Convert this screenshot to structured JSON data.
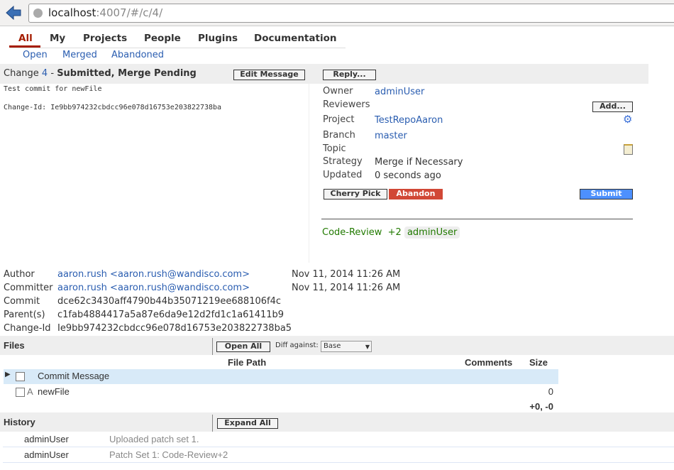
{
  "browser": {
    "url_host": "localhost",
    "url_path": ":4007/#/c/4/"
  },
  "nav": {
    "tabs": [
      "All",
      "My",
      "Projects",
      "People",
      "Plugins",
      "Documentation"
    ],
    "active": "All",
    "subtabs": [
      "Open",
      "Merged",
      "Abandoned"
    ],
    "accent": "#a51d00"
  },
  "change": {
    "prefix": "Change",
    "number": "4",
    "sep": "-",
    "status": "Submitted, Merge Pending",
    "edit_message": "Edit Message",
    "reply": "Reply...",
    "message_line1": "Test commit for newFile",
    "message_line2": "Change-Id: Ie9bb974232cbdcc96e078d16753e203822738ba"
  },
  "info": {
    "owner_label": "Owner",
    "owner": "adminUser",
    "reviewers_label": "Reviewers",
    "add": "Add...",
    "project_label": "Project",
    "project": "TestRepoAaron",
    "branch_label": "Branch",
    "branch": "master",
    "topic_label": "Topic",
    "strategy_label": "Strategy",
    "strategy": "Merge if Necessary",
    "updated_label": "Updated",
    "updated": "0 seconds ago",
    "cherry_pick": "Cherry Pick",
    "abandon": "Abandon",
    "submit": "Submit",
    "abandon_color": "#d14836",
    "submit_color": "#4d90fe",
    "label_name": "Code-Review",
    "label_value": "+2",
    "label_user": "adminUser"
  },
  "commit": {
    "author_label": "Author",
    "author": "aaron.rush <aaron.rush@wandisco.com>",
    "author_date": "Nov 11, 2014 11:26 AM",
    "committer_label": "Committer",
    "committer": "aaron.rush <aaron.rush@wandisco.com>",
    "committer_date": "Nov 11, 2014 11:26 AM",
    "commit_label": "Commit",
    "commit": "dce62c3430aff4790b44b35071219ee688106f4c",
    "parent_label": "Parent(s)",
    "parent": "c1fab4884417a5a87e6da9e12d2fd1c1a61411b9",
    "changeid_label": "Change-Id",
    "changeid": "Ie9bb974232cbdcc96e078d16753e203822738ba5"
  },
  "files": {
    "title": "Files",
    "open_all": "Open All",
    "diff_label": "Diff against:",
    "diff_value": "Base",
    "col_path": "File Path",
    "col_comments": "Comments",
    "col_size": "Size",
    "rows": [
      {
        "status": "",
        "name": "Commit Message",
        "size": ""
      },
      {
        "status": "A",
        "name": "newFile",
        "size": "0"
      }
    ],
    "total": "+0, -0"
  },
  "history": {
    "title": "History",
    "expand_all": "Expand All",
    "rows": [
      {
        "user": "adminUser",
        "text": "Uploaded patch set 1."
      },
      {
        "user": "adminUser",
        "text": "Patch Set 1: Code-Review+2"
      }
    ]
  }
}
